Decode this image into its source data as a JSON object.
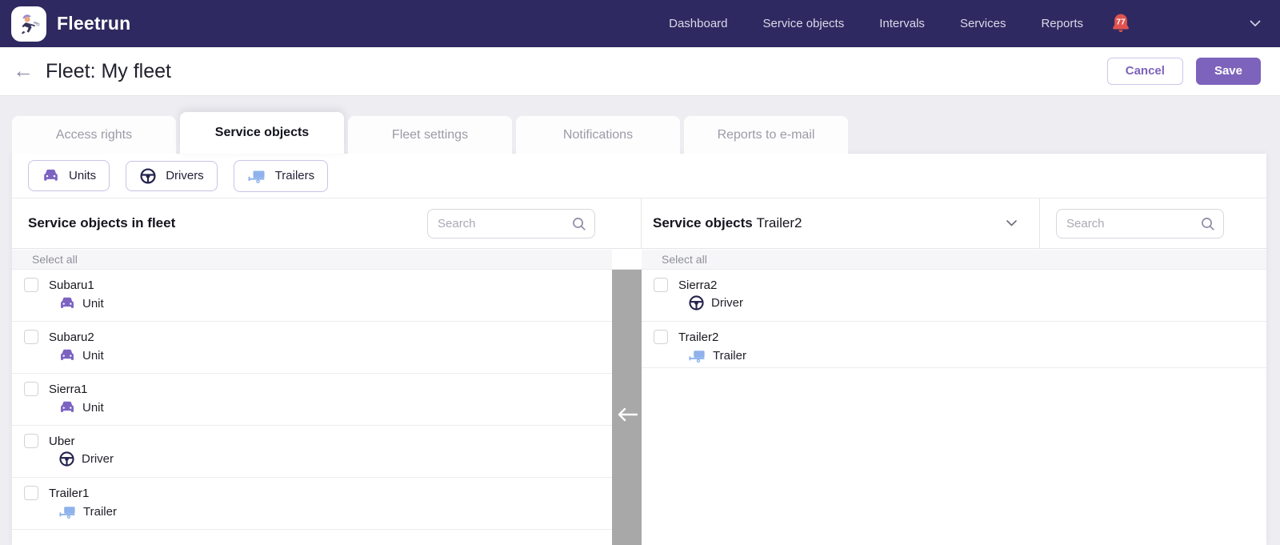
{
  "nav": {
    "brand": "Fleetrun",
    "items": [
      "Dashboard",
      "Service objects",
      "Intervals",
      "Services",
      "Reports"
    ],
    "notifications_count": "77"
  },
  "header": {
    "title": "Fleet: My fleet",
    "cancel_label": "Cancel",
    "save_label": "Save"
  },
  "tabs": [
    {
      "label": "Access rights"
    },
    {
      "label": "Service objects"
    },
    {
      "label": "Fleet settings"
    },
    {
      "label": "Notifications"
    },
    {
      "label": "Reports to e-mail"
    }
  ],
  "active_tab": "Service objects",
  "toolbar": {
    "filters": [
      {
        "label": "Units",
        "icon": "unit-icon"
      },
      {
        "label": "Drivers",
        "icon": "driver-icon"
      },
      {
        "label": "Trailers",
        "icon": "trailer-icon"
      }
    ]
  },
  "left_panel": {
    "title": "Service objects in fleet",
    "search_placeholder": "Search",
    "search_value": "",
    "select_all_label": "Select all",
    "items": [
      {
        "name": "Subaru1",
        "type": "Unit"
      },
      {
        "name": "Subaru2",
        "type": "Unit"
      },
      {
        "name": "Sierra1",
        "type": "Unit"
      },
      {
        "name": "Uber",
        "type": "Driver"
      },
      {
        "name": "Trailer1",
        "type": "Trailer"
      }
    ]
  },
  "right_panel": {
    "title_prefix": "Service objects",
    "selected_object": "Trailer2",
    "search_placeholder": "Search",
    "search_value": "",
    "select_all_label": "Select all",
    "items": [
      {
        "name": "Sierra2",
        "type": "Driver"
      },
      {
        "name": "Trailer2",
        "type": "Trailer"
      }
    ]
  },
  "colors": {
    "navbar": "#2e2960",
    "accent_purple": "#7d63bb",
    "unit_icon": "#7c63c2",
    "driver_icon": "#23234d",
    "trailer_icon": "#8fb2ec",
    "bell_red": "#e0534f",
    "transfer_bar_gray": "#a8a8a8"
  }
}
